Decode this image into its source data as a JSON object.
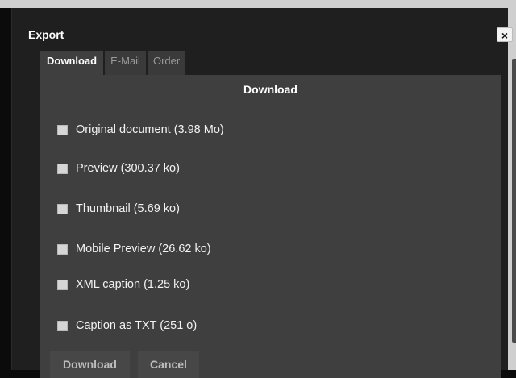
{
  "dialog": {
    "title": "Export",
    "close_label": "×"
  },
  "tabs": [
    {
      "label": "Download",
      "active": true
    },
    {
      "label": "E-Mail",
      "active": false
    },
    {
      "label": "Order",
      "active": false
    }
  ],
  "panel": {
    "heading": "Download",
    "options": [
      {
        "label": "Original document (3.98 Mo)",
        "checked": false
      },
      {
        "label": "Preview (300.37 ko)",
        "checked": false
      },
      {
        "label": "Thumbnail (5.69 ko)",
        "checked": false
      },
      {
        "label": "Mobile Preview (26.62 ko)",
        "checked": false
      },
      {
        "label": "XML caption (1.25 ko)",
        "checked": false
      },
      {
        "label": "Caption as TXT (251 o)",
        "checked": false
      }
    ]
  },
  "buttons": {
    "download_label": "Download",
    "cancel_label": "Cancel"
  },
  "colors": {
    "background": "#1f1f1f",
    "panel": "#3f3f3f",
    "tab_inactive": "#3a3a3a",
    "text": "#ffffff"
  }
}
